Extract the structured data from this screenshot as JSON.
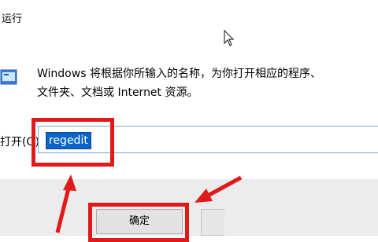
{
  "window": {
    "title": "运行"
  },
  "dialog": {
    "description_line1": "Windows 将根据你所输入的名称，为你打开相应的程序、",
    "description_line2": "文件夹、文档或 Internet 资源。",
    "open_label": "打开(O):",
    "open_value": "regedit",
    "ok_label": "确定"
  },
  "annotation": {
    "color": "#e01a1a"
  },
  "icons": [
    "mouse-cursor",
    "run-app-icon",
    "red-arrow-up",
    "red-arrow-left"
  ]
}
